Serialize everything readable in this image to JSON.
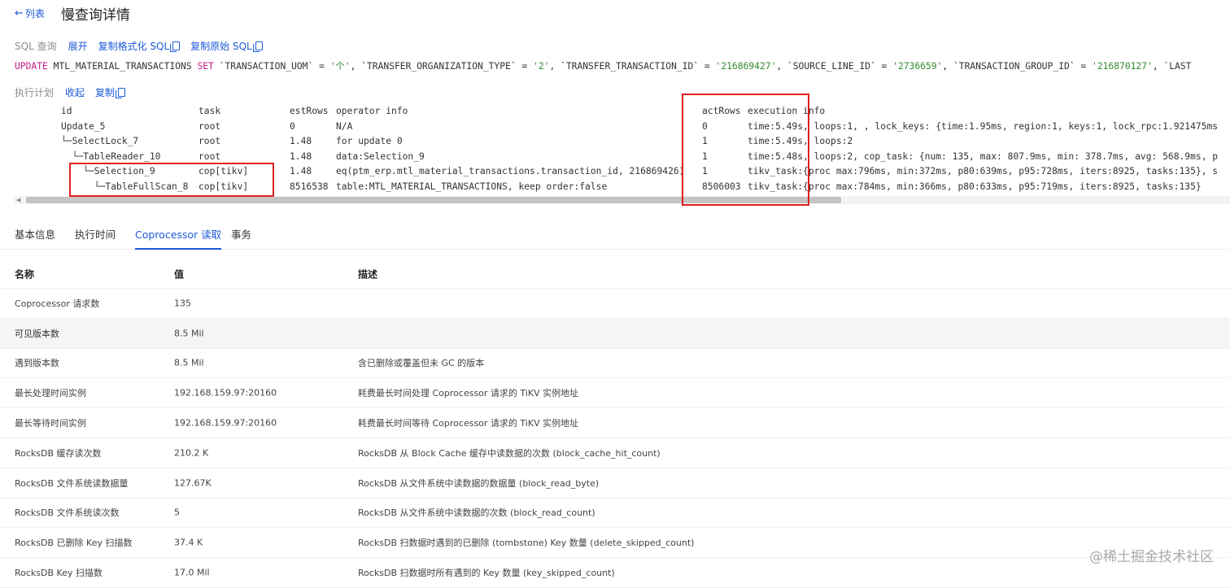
{
  "header": {
    "back_label": "列表",
    "title": "慢查询详情"
  },
  "sql_section": {
    "label": "SQL 查询",
    "expand": "展开",
    "copy_formatted": "复制格式化 SQL",
    "copy_raw": "复制原始 SQL",
    "sql": {
      "update": "UPDATE",
      "table": " MTL_MATERIAL_TRANSACTIONS ",
      "set": "SET",
      "c1": " `TRANSACTION_UOM` = ",
      "v1": "'个'",
      "c2": ", `TRANSFER_ORGANIZATION_TYPE` = ",
      "v2": "'2'",
      "c3": ", `TRANSFER_TRANSACTION_ID` = ",
      "v3": "'216869427'",
      "c4": ", `SOURCE_LINE_ID` = ",
      "v4": "'2736659'",
      "c5": ", `TRANSACTION_GROUP_ID` = ",
      "v5": "'216870127'",
      "c6": ", `LAST"
    }
  },
  "plan_section": {
    "label": "执行计划",
    "collapse": "收起",
    "copy": "复制",
    "rows": [
      {
        "id": "id",
        "task": "task",
        "est": "estRows",
        "op": "operator info",
        "act": "actRows",
        "exec": "execution info"
      },
      {
        "id": "Update_5",
        "task": "root",
        "est": "0",
        "op": "N/A",
        "act": "0",
        "exec": "time:5.49s, loops:1, , lock_keys: {time:1.95ms, region:1, keys:1, lock_rpc:1.921475ms"
      },
      {
        "id": "└─SelectLock_7",
        "task": "root",
        "est": "1.48",
        "op": "for update 0",
        "act": "1",
        "exec": "time:5.49s, loops:2"
      },
      {
        "id": "  └─TableReader_10",
        "task": "root",
        "est": "1.48",
        "op": "data:Selection_9",
        "act": "1",
        "exec": "time:5.48s, loops:2, cop_task: {num: 135, max: 807.9ms, min: 378.7ms, avg: 568.9ms, p"
      },
      {
        "id": "    └─Selection_9",
        "task": "cop[tikv]",
        "est": "1.48",
        "op": "eq(ptm_erp.mtl_material_transactions.transaction_id, 216869426)",
        "act": "1",
        "exec": "tikv_task:{proc max:796ms, min:372ms, p80:639ms, p95:728ms, iters:8925, tasks:135}, s"
      },
      {
        "id": "      └─TableFullScan_8",
        "task": "cop[tikv]",
        "est": "8516538",
        "op": "table:MTL_MATERIAL_TRANSACTIONS, keep order:false",
        "act": "8506003",
        "exec": "tikv_task:{proc max:784ms, min:366ms, p80:633ms, p95:719ms, iters:8925, tasks:135}"
      }
    ]
  },
  "tabs": [
    {
      "label": "基本信息"
    },
    {
      "label": "执行时间"
    },
    {
      "label": "Coprocessor 读取"
    },
    {
      "label": "事务"
    }
  ],
  "table": {
    "headers": {
      "name": "名称",
      "value": "值",
      "desc": "描述"
    },
    "rows": [
      {
        "name": "Coprocessor 请求数",
        "value": "135",
        "desc": ""
      },
      {
        "name": "可见版本数",
        "value": "8.5 Mil",
        "desc": ""
      },
      {
        "name": "遇到版本数",
        "value": "8.5 Mil",
        "desc": "含已删除或覆盖但未 GC 的版本"
      },
      {
        "name": "最长处理时间实例",
        "value": "192.168.159.97:20160",
        "desc": "耗费最长时间处理 Coprocessor 请求的 TiKV 实例地址"
      },
      {
        "name": "最长等待时间实例",
        "value": "192.168.159.97:20160",
        "desc": "耗费最长时间等待 Coprocessor 请求的 TiKV 实例地址"
      },
      {
        "name": "RocksDB 缓存读次数",
        "value": "210.2 K",
        "desc": "RocksDB 从 Block Cache 缓存中读数据的次数 (block_cache_hit_count)"
      },
      {
        "name": "RocksDB 文件系统读数据量",
        "value": "127.67K",
        "desc": "RocksDB 从文件系统中读数据的数据量 (block_read_byte)"
      },
      {
        "name": "RocksDB 文件系统读次数",
        "value": "5",
        "desc": "RocksDB 从文件系统中读数据的次数 (block_read_count)"
      },
      {
        "name": "RocksDB 已删除 Key 扫描数",
        "value": "37.4 K",
        "desc": "RocksDB 扫数据时遇到的已删除 (tombstone) Key 数量 (delete_skipped_count)"
      },
      {
        "name": "RocksDB Key 扫描数",
        "value": "17.0 Mil",
        "desc": "RocksDB 扫数据时所有遇到的 Key 数量 (key_skipped_count)"
      }
    ]
  },
  "watermark": "@稀土掘金技术社区"
}
